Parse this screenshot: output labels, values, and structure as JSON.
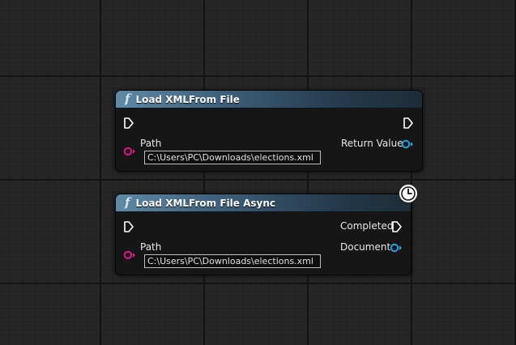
{
  "nodes": [
    {
      "title": "Load XMLFrom File",
      "input_pin_label": "Path",
      "input_value": "C:\\Users\\PC\\Downloads\\elections.xml",
      "output_pin_label": "Return Value"
    },
    {
      "title": "Load XMLFrom File Async",
      "input_pin_label": "Path",
      "input_value": "C:\\Users\\PC\\Downloads\\elections.xml",
      "completed_label": "Completed",
      "output_pin_label": "Document"
    }
  ],
  "colors": {
    "canvas": "#262626",
    "header_accent": "#5f8aa8",
    "string_pin": "#e3148a",
    "object_pin": "#1aa4e6",
    "exec_pin": "#ffffff"
  },
  "icons": {
    "function": "function-icon",
    "latent": "clock-icon",
    "exec": "exec-pin-icon"
  }
}
